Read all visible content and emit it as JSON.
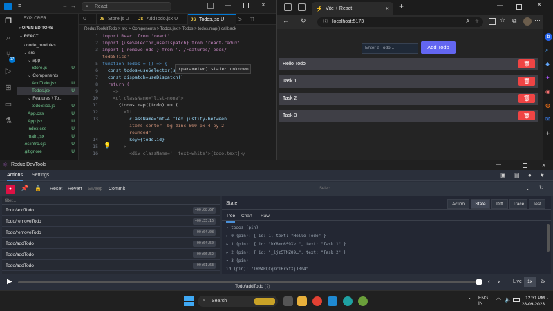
{
  "vscode": {
    "search_text": "React",
    "sidebar": {
      "title": "EXPLORER",
      "sections": [
        "OPEN EDITORS",
        "REACT"
      ],
      "files": [
        {
          "label": "node_modules",
          "indent": 1,
          "badge": ""
        },
        {
          "label": "src",
          "indent": 1,
          "badge": ""
        },
        {
          "label": "app",
          "indent": 2,
          "badge": ""
        },
        {
          "label": "Store.js",
          "indent": 3,
          "badge": "U"
        },
        {
          "label": "Components",
          "indent": 2,
          "badge": ""
        },
        {
          "label": "AddTodo.jsx",
          "indent": 3,
          "badge": "U"
        },
        {
          "label": "Todos.jsx",
          "indent": 3,
          "badge": "U"
        },
        {
          "label": "Features \\ To...",
          "indent": 2,
          "badge": ""
        },
        {
          "label": "todoSlice.js",
          "indent": 3,
          "badge": "U"
        },
        {
          "label": "App.css",
          "indent": 2,
          "badge": "U"
        },
        {
          "label": "App.jsx",
          "indent": 2,
          "badge": "U"
        },
        {
          "label": "index.css",
          "indent": 2,
          "badge": "U"
        },
        {
          "label": "main.jsx",
          "indent": 2,
          "badge": "U"
        },
        {
          "label": ".eslintrc.cjs",
          "indent": 1,
          "badge": "U"
        },
        {
          "label": ".gitignore",
          "indent": 1,
          "badge": "U"
        }
      ]
    },
    "tabs": [
      {
        "label": "U",
        "active": false
      },
      {
        "label": "Store.js U",
        "active": false
      },
      {
        "label": "AddTodo.jsx U",
        "active": false
      },
      {
        "label": "Todos.jsx U",
        "active": true
      }
    ],
    "breadcrumb": "ReduxToolkitTodo > src > Components > Todos.jsx > Todos > todos.map() callback",
    "code_lines": [
      {
        "n": "1",
        "t": "import React from 'react'"
      },
      {
        "n": "2",
        "t": "import {useSelector,useDispatch} from 'react-redux'"
      },
      {
        "n": "3",
        "t": "import { removeTodo } from '../Features/Todos/"
      },
      {
        "n": "",
        "t": "todoSlice'"
      },
      {
        "n": "5",
        "t": "function Todos = () => {"
      },
      {
        "n": "6",
        "t": "  const todos=useSelector(state=>state.todos)"
      },
      {
        "n": "7",
        "t": "  const dispatch=useDispatch()"
      },
      {
        "n": "8",
        "t": "  return ("
      },
      {
        "n": "9",
        "t": "    <>"
      },
      {
        "n": "10",
        "t": "    <ul className=\"list-none\">"
      },
      {
        "n": "11",
        "t": "      {todos.map((todo) => ("
      },
      {
        "n": "12",
        "t": "        <li"
      },
      {
        "n": "13",
        "t": "          className=\"mt-4 flex justify-between"
      },
      {
        "n": "",
        "t": "          items-center  bg-zinc-800 px-4 py-2"
      },
      {
        "n": "",
        "t": "          rounded\""
      },
      {
        "n": "14",
        "t": "          key={todo.id}"
      },
      {
        "n": "15",
        "t": "        >"
      },
      {
        "n": "16",
        "t": "          <div className='  text-white'>{todo.text}</"
      }
    ],
    "tooltip": "(parameter) state: unknown"
  },
  "browser": {
    "tab_title": "Vite + React",
    "url": "localhost:5173",
    "input_placeholder": "Enter a Todo...",
    "add_button": "Add Todo",
    "todos": [
      "Hello Todo",
      "Task 1",
      "Task 2",
      "Task 3"
    ],
    "delete_icon": "trash-icon"
  },
  "devtools": {
    "window_title": "Redux DevTools",
    "nav": [
      "Actions",
      "Settings"
    ],
    "toolbar": {
      "reset": "Reset",
      "revert": "Revert",
      "sweep": "Sweep",
      "commit": "Commit",
      "select_placeholder": "Select..."
    },
    "filter_placeholder": "filter...",
    "actions": [
      {
        "name": "Todo/addTodo",
        "time": "+00:08.67"
      },
      {
        "name": "Todo/removeTodo",
        "time": "+00:33.16"
      },
      {
        "name": "Todo/removeTodo",
        "time": "+00:04.08"
      },
      {
        "name": "Todo/addTodo",
        "time": "+00:04.50"
      },
      {
        "name": "Todo/addTodo",
        "time": "+00:06.52"
      },
      {
        "name": "Todo/addTodo",
        "time": "+00:01.63"
      }
    ],
    "panel_title": "State",
    "view_tabs": [
      "Action",
      "State",
      "Diff",
      "Trace",
      "Test"
    ],
    "active_view": "State",
    "sub_tabs": [
      "Tree",
      "Chart",
      "Raw"
    ],
    "state_tree": [
      "▾ todos (pin)",
      "  ▸ 0 (pin): { id: 1, text: \"Hello Todo\" }",
      "  ▸ 1 (pin): { id: \"hY8mo6S9Xv…\", text: \"Task 1\" }",
      "  ▸ 2 (pin): { id: \"_ljz5TMZO9…\", text: \"Task 2\" }",
      "  ▾ 3 (pin)",
      "      id (pin): \"1RM4RQCqKr1BrxfXjJRd4\""
    ],
    "slider_label": "Todo/addTodo",
    "slider_hint": "(?)",
    "live": "Live",
    "speed1": "1x",
    "speed2": "2x"
  },
  "taskbar": {
    "search": "Search",
    "lang1": "ENG",
    "lang2": "IN",
    "time": "12:31 PM",
    "date": "28-09-2023"
  },
  "colors": {
    "accent": "#6366f1",
    "delete": "#ef4444",
    "todo_row": "#3f3f46",
    "vscode_active_tab": "#0078d4"
  }
}
